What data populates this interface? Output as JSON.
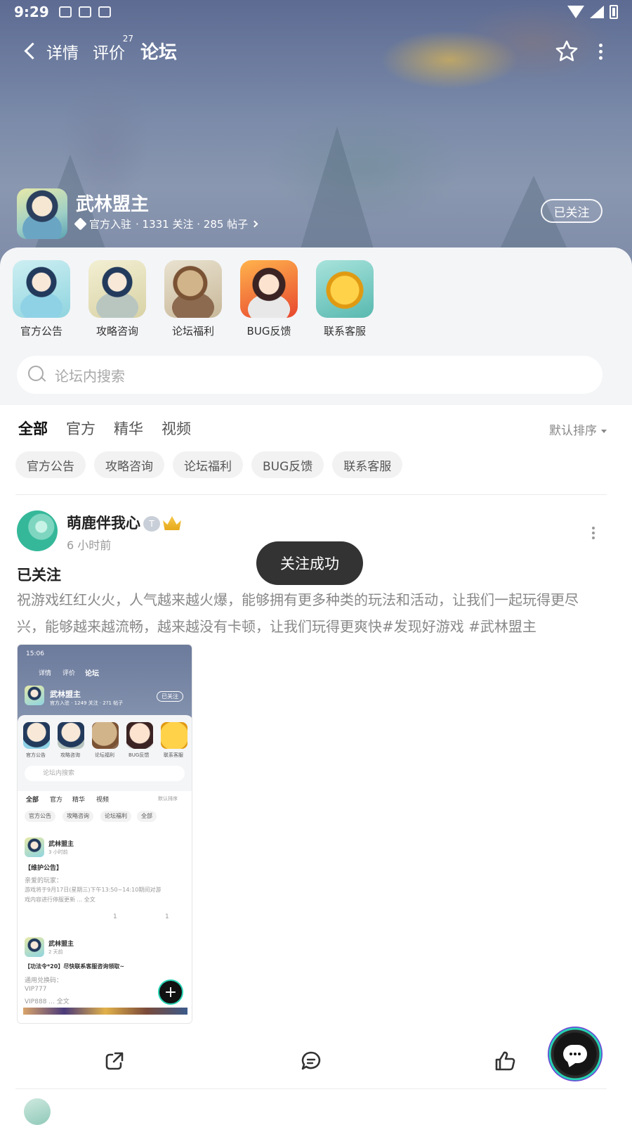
{
  "status_bar": {
    "time": "9:29"
  },
  "header": {
    "back_icon": "back-icon",
    "tabs": [
      {
        "label": "详情",
        "active": false
      },
      {
        "label": "评价",
        "badge": "27",
        "active": false
      },
      {
        "label": "论坛",
        "active": true
      }
    ],
    "star_icon": "star-outline-icon",
    "more_icon": "more-vertical-icon"
  },
  "game": {
    "title": "武林盟主",
    "verified_label": "官方入驻",
    "stats": "· 1331 关注 · 285 帖子",
    "follow_label": "已关注"
  },
  "categories": [
    {
      "label": "官方公告"
    },
    {
      "label": "攻略咨询"
    },
    {
      "label": "论坛福利"
    },
    {
      "label": "BUG反馈"
    },
    {
      "label": "联系客服"
    }
  ],
  "search": {
    "placeholder": "论坛内搜索"
  },
  "feed": {
    "tabs": [
      "全部",
      "官方",
      "精华",
      "视频"
    ],
    "active_tab": "全部",
    "sort_label": "默认排序",
    "chips": [
      "官方公告",
      "攻略咨询",
      "论坛福利",
      "BUG反馈",
      "联系客服"
    ]
  },
  "post": {
    "username": "萌鹿伴我心",
    "level_badge": "T",
    "time": "6 小时前",
    "title": "已关注",
    "body": "祝游戏红红火火，人气越来越火爆，能够拥有更多种类的玩法和活动，让我们一起玩得更尽兴，能够越来越流畅，越来越没有卡顿，让我们玩得更爽快#发现好游戏 #武林盟主",
    "screenshot": {
      "time": "15:06",
      "tabs": [
        "详情",
        "评价",
        "论坛"
      ],
      "title": "武林盟主",
      "meta": "官方入驻 · 1249 关注 · 2?1 帖子",
      "follow": "已关注",
      "cats": [
        "官方公告",
        "攻略咨询",
        "论坛福利",
        "BUG反馈",
        "联系客服"
      ],
      "search": "论坛内搜索",
      "tabs2": [
        "全部",
        "官方",
        "精华",
        "视频"
      ],
      "sort": "默认排序",
      "chips": [
        "官方公告",
        "攻略咨询",
        "论坛福利",
        "全部"
      ],
      "p1_user": "武林盟主",
      "p1_time": "3 小时前",
      "p1_title": "【维护公告】",
      "p1_l1": "亲爱的玩家：",
      "p1_l2": "游戏将于9月17日(星期三)下午13:50~14:10期间对游",
      "p1_l3": "戏内容进行停服更新 ... 全文",
      "p1_comments": "1",
      "p1_likes": "1",
      "p2_user": "武林盟主",
      "p2_time": "2 天前",
      "p2_title": "【功法令*20】尽快联系客服咨询领取~",
      "p2_l1": "通用兑换码：",
      "p2_l2": "VIP777",
      "p2_l3": "VIP888 ... 全文"
    }
  },
  "toast": "关注成功",
  "actions": {
    "share_icon": "share-icon",
    "comment_icon": "comment-icon",
    "like_icon": "thumbs-up-icon"
  },
  "fab_icon": "chat-bubble-icon",
  "colors": {
    "accent": "#27d3b4",
    "toast_bg": "#333333"
  }
}
